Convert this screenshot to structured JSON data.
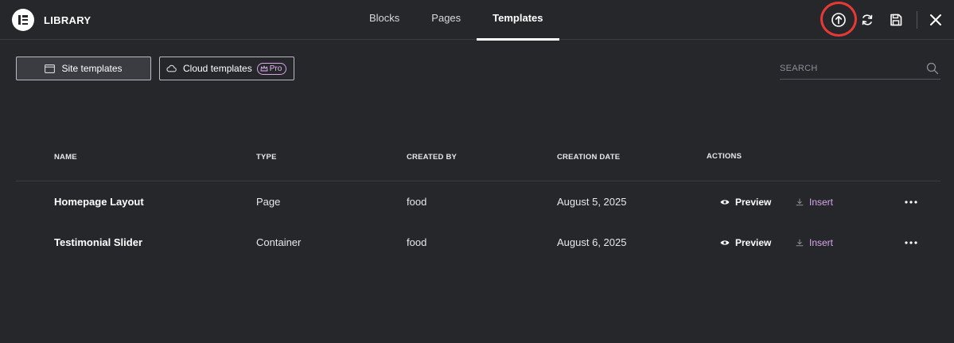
{
  "header": {
    "brand": "LIBRARY",
    "tabs": [
      {
        "label": "Blocks",
        "active": false
      },
      {
        "label": "Pages",
        "active": false
      },
      {
        "label": "Templates",
        "active": true
      }
    ],
    "icons": [
      "upload-icon",
      "sync-icon",
      "save-icon",
      "close-icon"
    ],
    "highlight_color": "#e53935"
  },
  "filters": {
    "site": {
      "label": "Site templates",
      "icon": "folder-icon"
    },
    "cloud": {
      "label": "Cloud templates",
      "icon": "cloud-icon",
      "badge": "Pro"
    }
  },
  "search": {
    "placeholder": "SEARCH",
    "value": ""
  },
  "table": {
    "columns": [
      "NAME",
      "TYPE",
      "CREATED BY",
      "CREATION DATE",
      "ACTIONS"
    ],
    "rows": [
      {
        "name": "Homepage Layout",
        "type": "Page",
        "created_by": "food",
        "date": "August 5, 2025",
        "preview": "Preview",
        "insert": "Insert"
      },
      {
        "name": "Testimonial Slider",
        "type": "Container",
        "created_by": "food",
        "date": "August 6, 2025",
        "preview": "Preview",
        "insert": "Insert"
      }
    ]
  },
  "colors": {
    "background": "#26272b",
    "accent_pro": "#d7a6e9"
  }
}
